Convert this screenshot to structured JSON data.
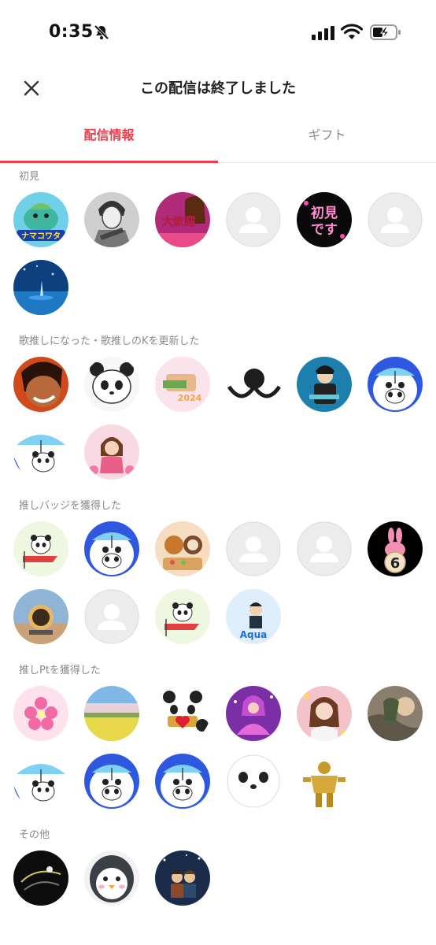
{
  "status_bar": {
    "time": "0:35"
  },
  "header": {
    "title": "この配信は終了しました"
  },
  "tabs": [
    {
      "label": "配信情報"
    },
    {
      "label": "ギフト"
    }
  ],
  "sections": [
    {
      "label": "初見"
    },
    {
      "label": "歌推しになった・歌推しのKを更新した"
    },
    {
      "label": "推しバッジを獲得した"
    },
    {
      "label": "推しPtを獲得した"
    },
    {
      "label": "その他"
    }
  ],
  "avatar_texts": {
    "namekowata": "ナマコワタ",
    "kangei": "大歓迎",
    "hatsumi_line1": "初見",
    "hatsumi_line2": "です",
    "year": "2024",
    "number": "6",
    "aqua": "Aqua"
  },
  "colors": {
    "accent": "#ef3b4a",
    "placeholder": "#e5e5e5"
  }
}
